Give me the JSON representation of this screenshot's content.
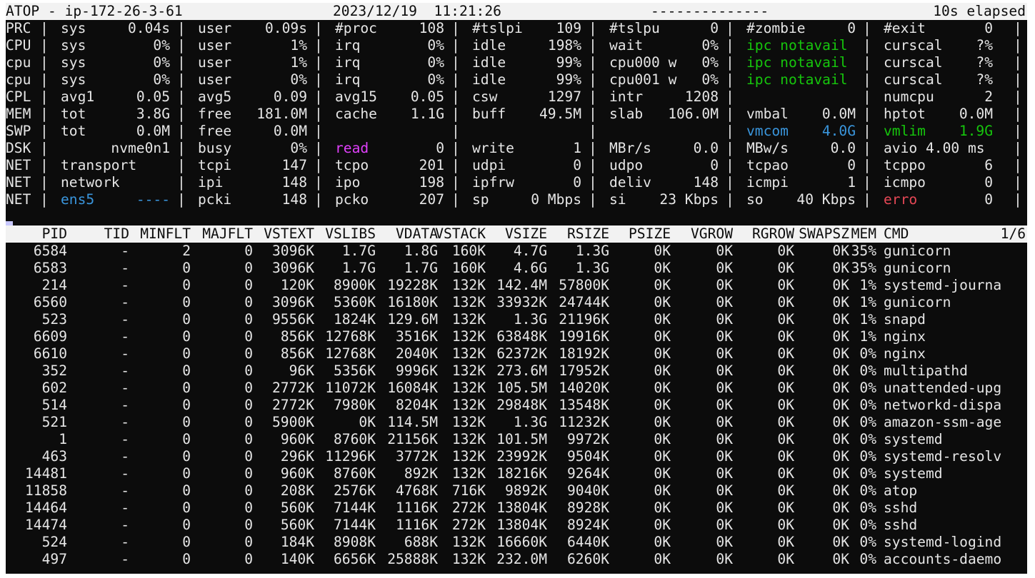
{
  "header": {
    "title": "ATOP - ip-172-26-3-61",
    "datetime": "2023/12/19  11:21:26",
    "flags": "--------------",
    "elapsed": "10s elapsed"
  },
  "colors": {
    "terminal_bg": "#0c0c0c",
    "text": "#e6e6e6",
    "green": "#16c60c",
    "cyan": "#3a96dd",
    "magenta": "#e040fb",
    "red": "#e74856",
    "inverse_bg": "#f2f2f2"
  },
  "system_rows": [
    {
      "label": "PRC",
      "cells": [
        {
          "k": "sys",
          "v": "0.04s"
        },
        {
          "k": "user",
          "v": "0.09s"
        },
        {
          "k": "#proc",
          "v": "108"
        },
        {
          "k": "#tslpi",
          "v": "109"
        },
        {
          "k": "#tslpu",
          "v": "0"
        },
        {
          "k": "#zombie",
          "v": "0"
        },
        {
          "k": "#exit",
          "v": "0"
        }
      ]
    },
    {
      "label": "CPU",
      "cells": [
        {
          "k": "sys",
          "v": "0%"
        },
        {
          "k": "user",
          "v": "1%"
        },
        {
          "k": "irq",
          "v": "0%"
        },
        {
          "k": "idle",
          "v": "198%"
        },
        {
          "k": "wait",
          "v": "0%"
        },
        {
          "k": "ipc notavail",
          "v": "",
          "color": "green"
        },
        {
          "k": "curscal",
          "v": "?%"
        }
      ]
    },
    {
      "label": "cpu",
      "cells": [
        {
          "k": "sys",
          "v": "0%"
        },
        {
          "k": "user",
          "v": "1%"
        },
        {
          "k": "irq",
          "v": "0%"
        },
        {
          "k": "idle",
          "v": "99%"
        },
        {
          "k": "cpu000 w",
          "v": "0%"
        },
        {
          "k": "ipc notavail",
          "v": "",
          "color": "green"
        },
        {
          "k": "curscal",
          "v": "?%"
        }
      ]
    },
    {
      "label": "cpu",
      "cells": [
        {
          "k": "sys",
          "v": "0%"
        },
        {
          "k": "user",
          "v": "0%"
        },
        {
          "k": "irq",
          "v": "0%"
        },
        {
          "k": "idle",
          "v": "99%"
        },
        {
          "k": "cpu001 w",
          "v": "0%"
        },
        {
          "k": "ipc notavail",
          "v": "",
          "color": "green"
        },
        {
          "k": "curscal",
          "v": "?%"
        }
      ]
    },
    {
      "label": "CPL",
      "cells": [
        {
          "k": "avg1",
          "v": "0.05"
        },
        {
          "k": "avg5",
          "v": "0.09"
        },
        {
          "k": "avg15",
          "v": "0.05"
        },
        {
          "k": "csw",
          "v": "1297"
        },
        {
          "k": "intr",
          "v": "1208"
        },
        {
          "k": "",
          "v": ""
        },
        {
          "k": "numcpu",
          "v": "2"
        }
      ]
    },
    {
      "label": "MEM",
      "cells": [
        {
          "k": "tot",
          "v": "3.8G"
        },
        {
          "k": "free",
          "v": "181.0M"
        },
        {
          "k": "cache",
          "v": "1.1G"
        },
        {
          "k": "buff",
          "v": "49.5M"
        },
        {
          "k": "slab",
          "v": "106.0M"
        },
        {
          "k": "vmbal",
          "v": "0.0M"
        },
        {
          "k": "hptot",
          "v": "0.0M"
        }
      ]
    },
    {
      "label": "SWP",
      "cells": [
        {
          "k": "tot",
          "v": "0.0M"
        },
        {
          "k": "free",
          "v": "0.0M"
        },
        {
          "k": "",
          "v": ""
        },
        {
          "k": "",
          "v": ""
        },
        {
          "k": "",
          "v": ""
        },
        {
          "k": "vmcom",
          "v": "4.0G",
          "color": "cyan"
        },
        {
          "k": "vmlim",
          "v": "1.9G",
          "color": "green"
        }
      ]
    },
    {
      "label": "DSK",
      "cells": [
        {
          "k": "",
          "v": "nvme0n1"
        },
        {
          "k": "busy",
          "v": "0%"
        },
        {
          "k": "read",
          "v": "0",
          "kcolor": "magenta"
        },
        {
          "k": "write",
          "v": "1"
        },
        {
          "k": "MBr/s",
          "v": "0.0"
        },
        {
          "k": "MBw/s",
          "v": "0.0"
        },
        {
          "k": "avio 4.00 ms",
          "v": ""
        }
      ]
    },
    {
      "label": "NET",
      "cells": [
        {
          "k": "transport",
          "v": ""
        },
        {
          "k": "tcpi",
          "v": "147"
        },
        {
          "k": "tcpo",
          "v": "201"
        },
        {
          "k": "udpi",
          "v": "0"
        },
        {
          "k": "udpo",
          "v": "0"
        },
        {
          "k": "tcpao",
          "v": "0"
        },
        {
          "k": "tcppo",
          "v": "6"
        }
      ]
    },
    {
      "label": "NET",
      "cells": [
        {
          "k": "network",
          "v": ""
        },
        {
          "k": "ipi",
          "v": "148"
        },
        {
          "k": "ipo",
          "v": "198"
        },
        {
          "k": "ipfrw",
          "v": "0"
        },
        {
          "k": "deliv",
          "v": "148"
        },
        {
          "k": "icmpi",
          "v": "1"
        },
        {
          "k": "icmpo",
          "v": "0"
        }
      ]
    },
    {
      "label": "NET",
      "cells": [
        {
          "k": "ens5",
          "v": "----",
          "color": "cyan"
        },
        {
          "k": "pcki",
          "v": "148"
        },
        {
          "k": "pcko",
          "v": "207"
        },
        {
          "k": "sp",
          "v": "0 Mbps"
        },
        {
          "k": "si",
          "v": "23 Kbps"
        },
        {
          "k": "so",
          "v": "40 Kbps"
        },
        {
          "k": "erro",
          "v": "0",
          "kcolor": "red"
        }
      ]
    }
  ],
  "process_table": {
    "columns": [
      "PID",
      "TID",
      "MINFLT",
      "MAJFLT",
      "VSTEXT",
      "VSLIBS",
      "VDATA",
      "VSTACK",
      "VSIZE",
      "RSIZE",
      "PSIZE",
      "VGROW",
      "RGROW",
      "SWAPSZ",
      "MEM",
      "CMD"
    ],
    "page": "1/6",
    "rows": [
      [
        "6584",
        "-",
        "2",
        "0",
        "3096K",
        "1.7G",
        "1.8G",
        "160K",
        "4.7G",
        "1.3G",
        "0K",
        "0K",
        "0K",
        "0K",
        "35%",
        "gunicorn"
      ],
      [
        "6583",
        "-",
        "0",
        "0",
        "3096K",
        "1.7G",
        "1.7G",
        "160K",
        "4.6G",
        "1.3G",
        "0K",
        "0K",
        "0K",
        "0K",
        "35%",
        "gunicorn"
      ],
      [
        "214",
        "-",
        "0",
        "0",
        "120K",
        "8900K",
        "19228K",
        "132K",
        "142.4M",
        "57800K",
        "0K",
        "0K",
        "0K",
        "0K",
        "1%",
        "systemd-journa"
      ],
      [
        "6560",
        "-",
        "0",
        "0",
        "3096K",
        "5360K",
        "16180K",
        "132K",
        "33932K",
        "24744K",
        "0K",
        "0K",
        "0K",
        "0K",
        "1%",
        "gunicorn"
      ],
      [
        "523",
        "-",
        "0",
        "0",
        "9556K",
        "1824K",
        "129.6M",
        "132K",
        "1.3G",
        "21196K",
        "0K",
        "0K",
        "0K",
        "0K",
        "1%",
        "snapd"
      ],
      [
        "6609",
        "-",
        "0",
        "0",
        "856K",
        "12768K",
        "3516K",
        "132K",
        "63848K",
        "19916K",
        "0K",
        "0K",
        "0K",
        "0K",
        "1%",
        "nginx"
      ],
      [
        "6610",
        "-",
        "0",
        "0",
        "856K",
        "12768K",
        "2040K",
        "132K",
        "62372K",
        "18192K",
        "0K",
        "0K",
        "0K",
        "0K",
        "0%",
        "nginx"
      ],
      [
        "352",
        "-",
        "0",
        "0",
        "96K",
        "5356K",
        "9996K",
        "132K",
        "273.6M",
        "17952K",
        "0K",
        "0K",
        "0K",
        "0K",
        "0%",
        "multipathd"
      ],
      [
        "602",
        "-",
        "0",
        "0",
        "2772K",
        "11072K",
        "16084K",
        "132K",
        "105.5M",
        "14020K",
        "0K",
        "0K",
        "0K",
        "0K",
        "0%",
        "unattended-upg"
      ],
      [
        "514",
        "-",
        "0",
        "0",
        "2772K",
        "7980K",
        "8204K",
        "132K",
        "29848K",
        "13548K",
        "0K",
        "0K",
        "0K",
        "0K",
        "0%",
        "networkd-dispa"
      ],
      [
        "521",
        "-",
        "0",
        "0",
        "5900K",
        "0K",
        "114.5M",
        "132K",
        "1.3G",
        "11232K",
        "0K",
        "0K",
        "0K",
        "0K",
        "0%",
        "amazon-ssm-age"
      ],
      [
        "1",
        "-",
        "0",
        "0",
        "960K",
        "8760K",
        "21156K",
        "132K",
        "101.5M",
        "9972K",
        "0K",
        "0K",
        "0K",
        "0K",
        "0%",
        "systemd"
      ],
      [
        "463",
        "-",
        "0",
        "0",
        "296K",
        "11296K",
        "3772K",
        "132K",
        "23992K",
        "9504K",
        "0K",
        "0K",
        "0K",
        "0K",
        "0%",
        "systemd-resolv"
      ],
      [
        "14481",
        "-",
        "0",
        "0",
        "960K",
        "8760K",
        "892K",
        "132K",
        "18216K",
        "9264K",
        "0K",
        "0K",
        "0K",
        "0K",
        "0%",
        "systemd"
      ],
      [
        "11858",
        "-",
        "0",
        "0",
        "208K",
        "2576K",
        "4768K",
        "716K",
        "9892K",
        "9040K",
        "0K",
        "0K",
        "0K",
        "0K",
        "0%",
        "atop"
      ],
      [
        "14464",
        "-",
        "0",
        "0",
        "560K",
        "7144K",
        "1116K",
        "272K",
        "13804K",
        "8928K",
        "0K",
        "0K",
        "0K",
        "0K",
        "0%",
        "sshd"
      ],
      [
        "14474",
        "-",
        "0",
        "0",
        "560K",
        "7144K",
        "1116K",
        "272K",
        "13804K",
        "8924K",
        "0K",
        "0K",
        "0K",
        "0K",
        "0%",
        "sshd"
      ],
      [
        "524",
        "-",
        "0",
        "0",
        "184K",
        "8908K",
        "688K",
        "132K",
        "16660K",
        "6440K",
        "0K",
        "0K",
        "0K",
        "0K",
        "0%",
        "systemd-logind"
      ],
      [
        "497",
        "-",
        "0",
        "0",
        "140K",
        "6656K",
        "25888K",
        "132K",
        "232.0M",
        "6260K",
        "0K",
        "0K",
        "0K",
        "0K",
        "0%",
        "accounts-daemo"
      ]
    ]
  }
}
